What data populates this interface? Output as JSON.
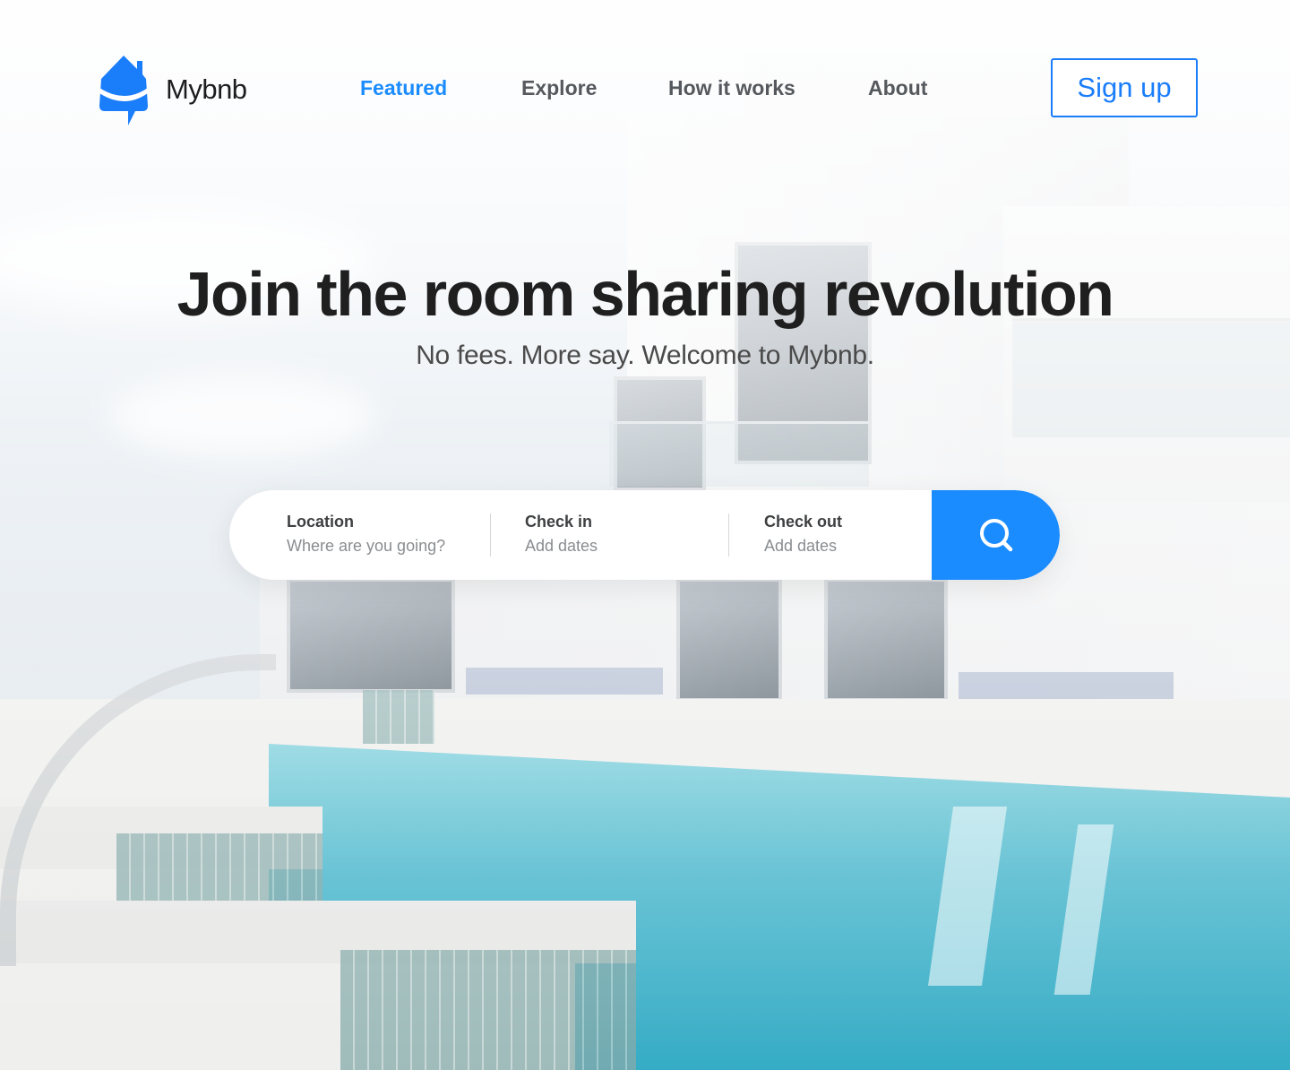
{
  "brand": {
    "name": "Mybnb",
    "accent_color": "#1a8cff",
    "logo_icon": "house-chat-icon"
  },
  "nav": {
    "items": [
      {
        "label": "Featured",
        "active": true
      },
      {
        "label": "Explore",
        "active": false
      },
      {
        "label": "How it works",
        "active": false
      },
      {
        "label": "About",
        "active": false
      }
    ],
    "signup_label": "Sign up"
  },
  "hero": {
    "title": "Join the room sharing revolution",
    "subtitle": "No fees. More say. Welcome to Mybnb."
  },
  "search": {
    "fields": [
      {
        "label": "Location",
        "placeholder": "Where are you going?"
      },
      {
        "label": "Check in",
        "placeholder": "Add dates"
      },
      {
        "label": "Check out",
        "placeholder": "Add dates"
      }
    ],
    "button_icon": "search-icon"
  }
}
